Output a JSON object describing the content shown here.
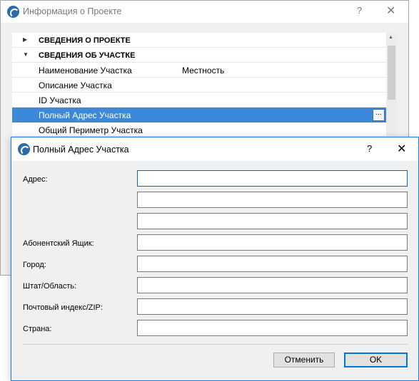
{
  "background_window": {
    "title": "Информация о Проекте",
    "help_glyph": "?",
    "close_glyph": "✕",
    "rows": [
      {
        "type": "group",
        "expanded": false,
        "arrow": "▶",
        "label": "СВЕДЕНИЯ О ПРОЕКТЕ"
      },
      {
        "type": "group",
        "expanded": true,
        "arrow": "▼",
        "label": "СВЕДЕНИЯ ОБ УЧАСТКЕ"
      },
      {
        "type": "item",
        "label": "Наименование Участка",
        "value": "Местность"
      },
      {
        "type": "item",
        "label": "Описание Участка",
        "value": ""
      },
      {
        "type": "item",
        "label": "ID Участка",
        "value": ""
      },
      {
        "type": "item",
        "label": "Полный Адрес Участка",
        "value": "",
        "selected": true,
        "button_label": "..."
      },
      {
        "type": "item",
        "label": "Общий Периметр Участка",
        "value": ""
      }
    ],
    "scroll_up_glyph": "▲"
  },
  "dialog": {
    "title": "Полный Адрес Участка",
    "help_glyph": "?",
    "close_glyph": "✕",
    "fields": {
      "address_label": "Адрес:",
      "address_line1": "",
      "address_line2": "",
      "address_line3": "",
      "po_box_label": "Абонентский Ящик:",
      "po_box": "",
      "city_label": "Город:",
      "city": "",
      "state_label": "Штат/Область:",
      "state": "",
      "zip_label": "Почтовый индекс/ZIP:",
      "zip": "",
      "country_label": "Страна:",
      "country": ""
    },
    "cancel_label": "Отменить",
    "ok_label": "OK"
  },
  "colors": {
    "selection": "#3b89d8",
    "focus_border": "#0a64c8",
    "default_button_border": "#0078d7",
    "logo": "#2c6aa8"
  },
  "icons": {
    "app_logo": "archicad-logo-icon",
    "help": "question-mark-icon",
    "close": "close-icon",
    "collapse_arrow": "triangle-right-icon",
    "expand_arrow": "triangle-down-icon",
    "browse": "ellipsis-icon"
  }
}
